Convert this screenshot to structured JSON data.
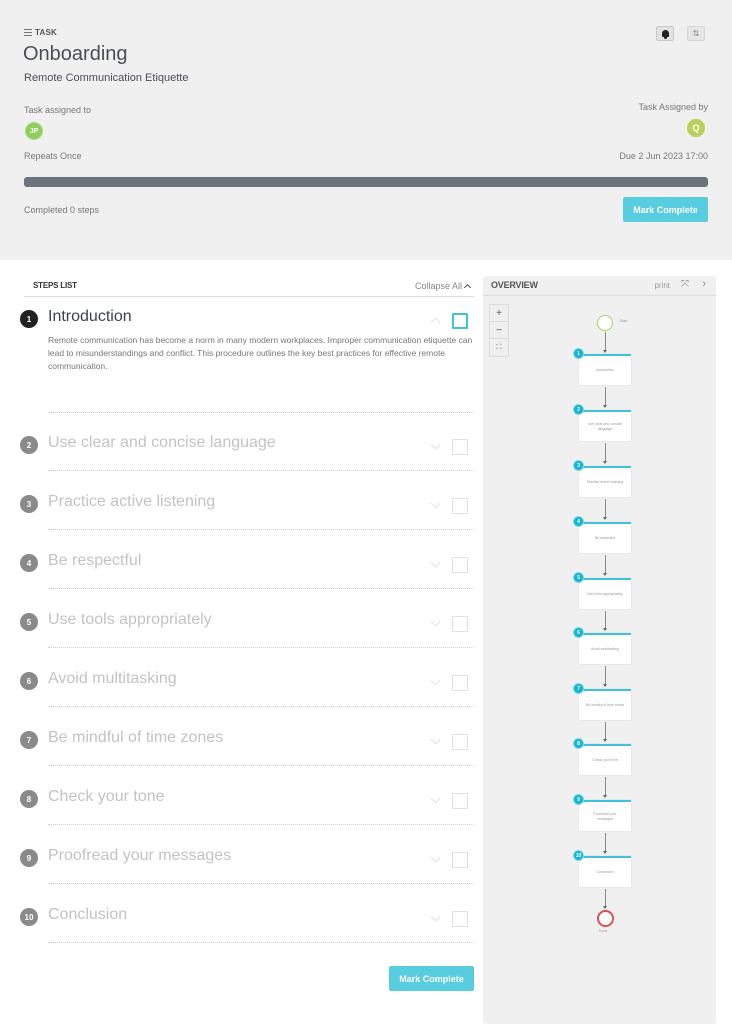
{
  "header": {
    "type_label": "TASK",
    "title": "Onboarding",
    "subtitle": "Remote Communication Etiquette",
    "assigned_to_label": "Task assigned to",
    "assigned_to_initials": "JP",
    "assigned_by_label": "Task Assigned by",
    "assigned_by_initials": "Q",
    "repeats": "Repeats Once",
    "due": "Due 2 Jun 2023 17:00",
    "progress_percent": 0,
    "completed_text": "Completed 0 steps",
    "mark_complete_label": "Mark Complete",
    "bell_icon": "bell-icon",
    "sort_icon": "sort-icon",
    "sort_glyph": "⇅"
  },
  "steps_list": {
    "title": "STEPS LIST",
    "collapse_all_label": "Collapse All",
    "steps": [
      {
        "num": "1",
        "title": "Introduction",
        "expanded": true,
        "body": "Remote communication has become a norm in many modern workplaces. Improper communication etiquette can lead to misunderstandings and conflict. This procedure outlines the key best practices for effective remote communication."
      },
      {
        "num": "2",
        "title": "Use clear and concise language"
      },
      {
        "num": "3",
        "title": "Practice active listening"
      },
      {
        "num": "4",
        "title": "Be respectful"
      },
      {
        "num": "5",
        "title": "Use tools appropriately"
      },
      {
        "num": "6",
        "title": "Avoid multitasking"
      },
      {
        "num": "7",
        "title": "Be mindful of time zones"
      },
      {
        "num": "8",
        "title": "Check your tone"
      },
      {
        "num": "9",
        "title": "Proofread your messages"
      },
      {
        "num": "10",
        "title": "Conclusion"
      }
    ],
    "mark_complete_label": "Mark Complete"
  },
  "overview": {
    "title": "OVERVIEW",
    "print_label": "print",
    "expand_glyph": "⤧",
    "next_glyph": "›",
    "zoom_in": "+",
    "zoom_out": "−",
    "fit_glyph": "⛶",
    "start_label": "Start",
    "end_label": "Done",
    "nodes": [
      {
        "num": "1",
        "label": "Introduction"
      },
      {
        "num": "2",
        "label": "Use clear and concise language"
      },
      {
        "num": "3",
        "label": "Practice active listening"
      },
      {
        "num": "4",
        "label": "Be respectful"
      },
      {
        "num": "5",
        "label": "Use tools appropriately"
      },
      {
        "num": "6",
        "label": "Avoid multitasking"
      },
      {
        "num": "7",
        "label": "Be mindful of time zones"
      },
      {
        "num": "8",
        "label": "Check your tone"
      },
      {
        "num": "9",
        "label": "Proofread your messages"
      },
      {
        "num": "10",
        "label": "Conclusion"
      }
    ]
  }
}
